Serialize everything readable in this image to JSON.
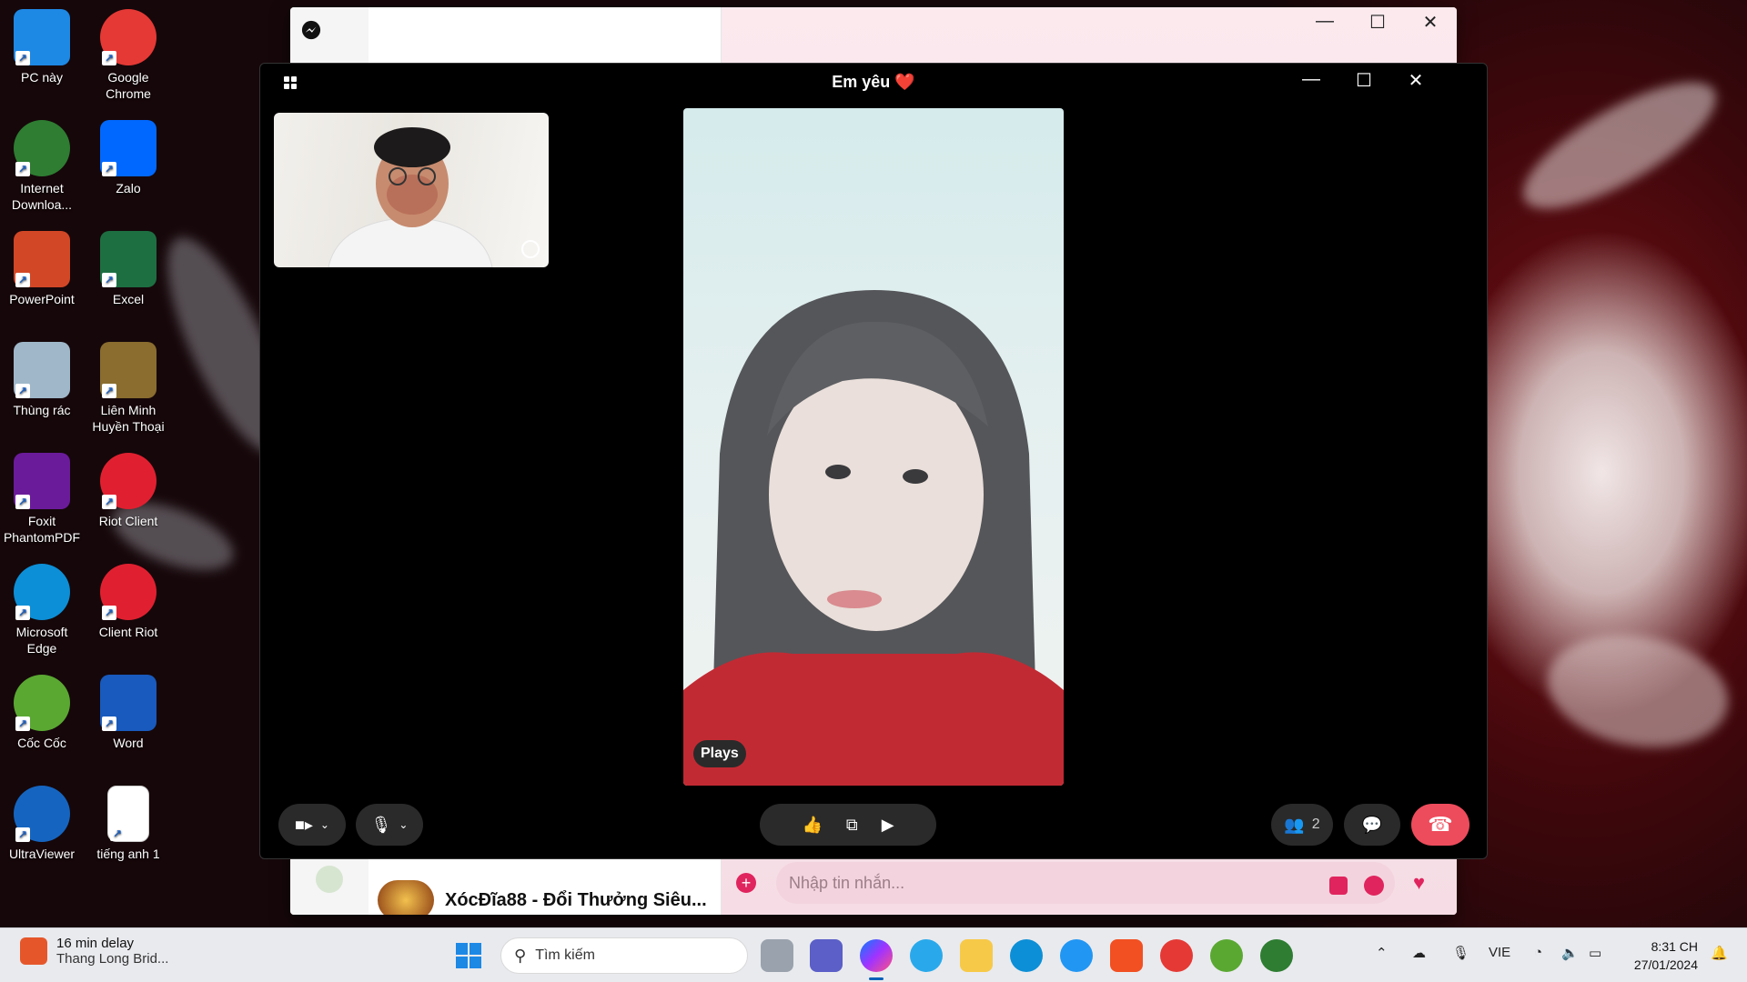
{
  "desktop": {
    "icons": [
      {
        "label": "PC này",
        "icon": "computer-icon",
        "color": "#1e88e5"
      },
      {
        "label": "Google Chrome",
        "icon": "chrome-icon",
        "color": "#e53935"
      },
      {
        "label": "Internet Downloa...",
        "icon": "idm-icon",
        "color": "#2e7d32"
      },
      {
        "label": "Zalo",
        "icon": "zalo-icon",
        "color": "#0068ff"
      },
      {
        "label": "PowerPoint",
        "icon": "powerpoint-icon",
        "color": "#d24726"
      },
      {
        "label": "Excel",
        "icon": "excel-icon",
        "color": "#1d6f42"
      },
      {
        "label": "Thùng rác",
        "icon": "recycle-bin-icon",
        "color": "#9fb7c9"
      },
      {
        "label": "Liên Minh Huyền Thoại",
        "icon": "league-of-legends-icon",
        "color": "#8a6d2f"
      },
      {
        "label": "Foxit PhantomPDF",
        "icon": "foxit-pdf-icon",
        "color": "#6a1b9a"
      },
      {
        "label": "Riot Client",
        "icon": "riot-client-icon",
        "color": "#e02030"
      },
      {
        "label": "Microsoft Edge",
        "icon": "edge-icon",
        "color": "#0c8fd6"
      },
      {
        "label": "Client Riot",
        "icon": "riot-client-icon",
        "color": "#e02030"
      },
      {
        "label": "Cốc Cốc",
        "icon": "coccoc-icon",
        "color": "#5aa832"
      },
      {
        "label": "Word",
        "icon": "word-icon",
        "color": "#185abd"
      },
      {
        "label": "UltraViewer",
        "icon": "ultraviewer-icon",
        "color": "#1565c0"
      },
      {
        "label": "tiếng anh 1",
        "icon": "word-document-icon",
        "color": "#ffffff"
      }
    ]
  },
  "background_window": {
    "app_icon": "messenger-icon",
    "header_contact": "Em yêu ❤️",
    "ad_title": "XócĐĩa88 - Đổi Thưởng Siêu...",
    "message_placeholder": "Nhập tin nhắn..."
  },
  "call": {
    "title": "Em yêu",
    "heart": "❤️",
    "main_label": "Plays",
    "participants_count": "2",
    "accent": "#ed4c5c"
  },
  "taskbar": {
    "weather_line1": "16 min delay",
    "weather_line2": "Thang Long Brid...",
    "search_placeholder": "Tìm kiếm",
    "language": "VIE",
    "time": "8:31 CH",
    "date": "27/01/2024"
  }
}
